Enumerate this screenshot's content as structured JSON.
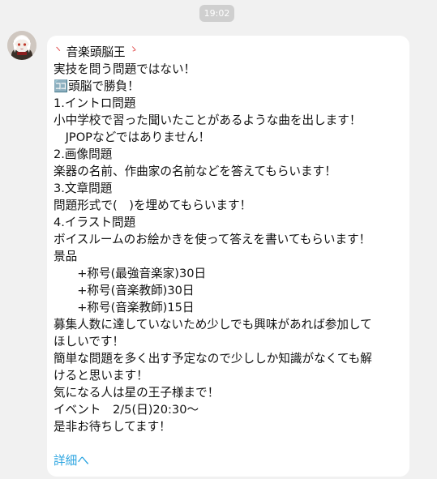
{
  "header": {
    "time": "19:02"
  },
  "avatar": {
    "icon": "anime-character-avatar"
  },
  "message": {
    "title": "音楽頭脳王",
    "title_icon_left": "ヽ",
    "title_icon_right": "ゝ",
    "lines": [
      "実技を問う問題ではない！",
      "🈁頭脳で勝負！",
      "1.イントロ問題",
      "小中学校で習った聞いたことがあるような曲を出します！",
      "　JPOPなどではありません！",
      "2.画像問題",
      "楽器の名前、作曲家の名前などを答えてもらいます！",
      "3.文章問題",
      "問題形式で(　)を埋めてもらいます！",
      "4.イラスト問題",
      "ボイスルームのお絵かきを使って答えを書いてもらいます！",
      "景品",
      "　　+称号(最強音楽家)30日",
      "　　+称号(音楽教師)30日",
      "　　+称号(音楽教師)15日",
      "募集人数に達していないため少しでも興味があれば参加して",
      "ほしいです！",
      "簡単な問題を多く出す予定なので少ししか知識がなくても解",
      "けると思います！",
      "気になる人は星の王子様まで！",
      "イベント　2/5(日)20:30〜",
      "是非お待ちしてます！"
    ],
    "details_link": "詳細へ"
  },
  "colors": {
    "background": "#f1f1f1",
    "bubble": "#ffffff",
    "text": "#111111",
    "link": "#2ba4e0",
    "time_pill": "#cfcfcf",
    "heart": "#e14a4a"
  }
}
